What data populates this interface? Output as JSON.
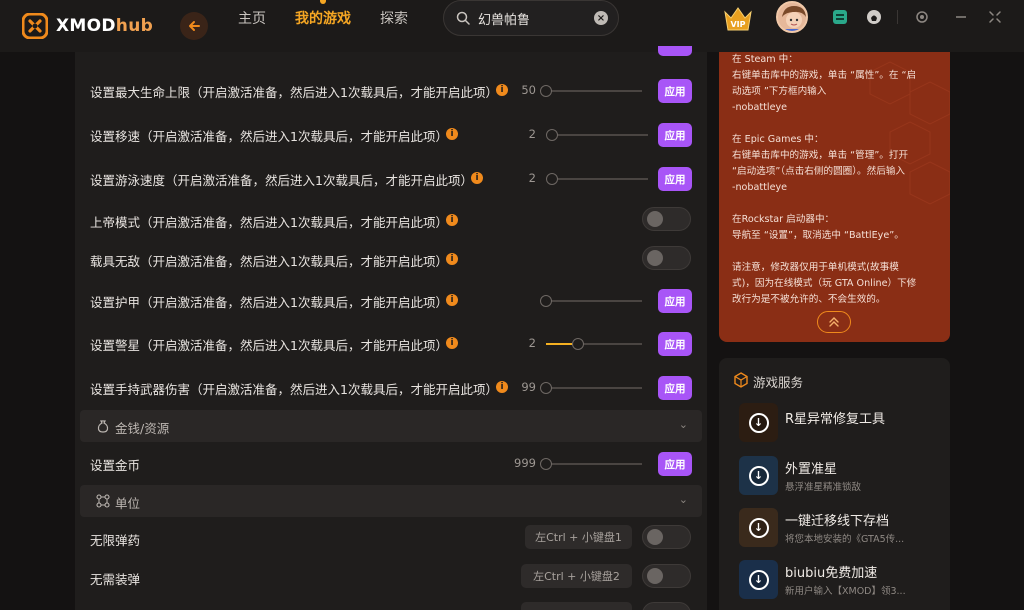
{
  "app": {
    "logo_main": "XMOD",
    "logo_sub": "hub"
  },
  "nav": {
    "home": "主页",
    "my_games": "我的游戏",
    "explore": "探索"
  },
  "search": {
    "value": "幻兽帕鲁"
  },
  "vip_label": "VIP",
  "cheats": [
    {
      "label": "设置最大生命上限（开启激活准备，然后进入1次载具后，才能开启此项）",
      "value": "50",
      "slider": 0.0,
      "apply": "应用"
    },
    {
      "label": "设置移速（开启激活准备，然后进入1次载具后，才能开启此项）",
      "value": "2",
      "slider": 0.0,
      "apply": "应用"
    },
    {
      "label": "设置游泳速度（开启激活准备，然后进入1次载具后，才能开启此项）",
      "value": "2",
      "slider": 0.0,
      "apply": "应用"
    },
    {
      "label": "上帝模式（开启激活准备，然后进入1次载具后，才能开启此项）"
    },
    {
      "label": "载具无敌（开启激活准备，然后进入1次载具后，才能开启此项）"
    },
    {
      "label": "设置护甲（开启激活准备，然后进入1次载具后，才能开启此项）",
      "value": "",
      "slider": 0.0,
      "apply": "应用"
    },
    {
      "label": "设置警星（开启激活准备，然后进入1次载具后，才能开启此项）",
      "value": "2",
      "slider": 0.33,
      "apply": "应用"
    },
    {
      "label": "设置手持武器伤害（开启激活准备，然后进入1次载具后，才能开启此项）",
      "value": "99",
      "slider": 0.0,
      "apply": "应用"
    }
  ],
  "section_money": {
    "label": "金钱/资源",
    "items": [
      {
        "label": "设置金币",
        "value": "999",
        "slider": 0.0,
        "apply": "应用"
      }
    ]
  },
  "section_unit": {
    "label": "单位",
    "items": [
      {
        "label": "无限弹药",
        "hotkey": "左Ctrl + 小键盘1"
      },
      {
        "label": "无需装弹",
        "hotkey": "左Ctrl + 小键盘2"
      }
    ]
  },
  "info_card": {
    "lines": [
      "在 Steam 中：",
      "右键单击库中的游戏，单击 “属性”。在 “启",
      "动选项 ”下方框内输入",
      "-nobattleye",
      "",
      "在 Epic Games 中：",
      "右键单击库中的游戏，单击 “管理”。打开",
      "“启动选项”（点击右侧的圆圈）。然后输入",
      "-nobattleye",
      "",
      "在Rockstar 启动器中：",
      "导航至 “设置”，取消选中 “BattlEye”。",
      "",
      "请注意，修改器仅用于单机模式(故事模",
      "式)，因为在线模式（玩 GTA Online）下修",
      "改行为是不被允许的、不会生效的。"
    ]
  },
  "services": {
    "title": "游戏服务",
    "items": [
      {
        "name": "R星异常修复工具",
        "desc": ""
      },
      {
        "name": "外置准星",
        "desc": "悬浮准星精准锁敌"
      },
      {
        "name": "一键迁移线下存档",
        "desc": "将您本地安装的《GTA5传..."
      },
      {
        "name": "biubiu免费加速",
        "desc": "新用户输入【XMOD】领3..."
      }
    ]
  },
  "colors": {
    "accent": "#f5a623",
    "apply": "#a855f7",
    "info_card": "#8a2e15"
  }
}
